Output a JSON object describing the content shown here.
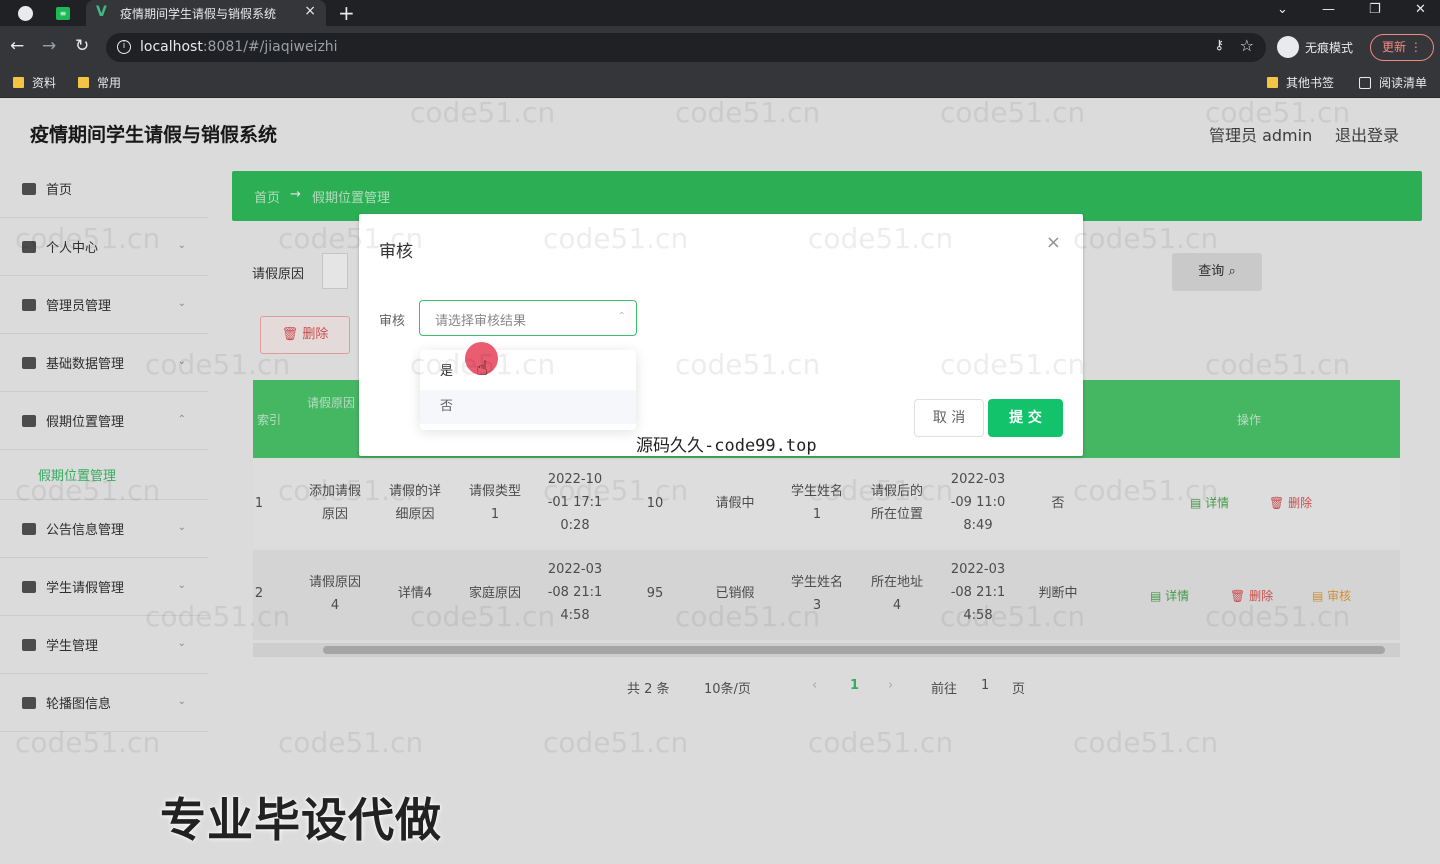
{
  "browser": {
    "tab_title": "疫情期间学生请假与销假系统",
    "url_host": "localhost",
    "url_rest": ":8081/#/jiaqiweizhi",
    "incognito_label": "无痕模式",
    "update_label": "更新",
    "bookmarks": [
      "资料",
      "常用"
    ],
    "bookmarks_right": [
      "其他书签",
      "阅读清单"
    ]
  },
  "header": {
    "system_title": "疫情期间学生请假与销假系统",
    "user": "管理员 admin",
    "logout": "退出登录"
  },
  "sidebar": {
    "items": [
      {
        "label": "首页",
        "icon": "home-icon"
      },
      {
        "label": "个人中心",
        "icon": "user-icon"
      },
      {
        "label": "管理员管理",
        "icon": "admin-icon"
      },
      {
        "label": "基础数据管理",
        "icon": "data-icon"
      },
      {
        "label": "假期位置管理",
        "icon": "location-icon"
      },
      {
        "label": "公告信息管理",
        "icon": "notice-icon"
      },
      {
        "label": "学生请假管理",
        "icon": "leave-icon"
      },
      {
        "label": "学生管理",
        "icon": "student-icon"
      },
      {
        "label": "轮播图信息",
        "icon": "carousel-icon"
      }
    ],
    "active_sub": "假期位置管理"
  },
  "breadcrumb": {
    "home": "首页",
    "arrow": "→",
    "current": "假期位置管理"
  },
  "search": {
    "label": "请假原因",
    "query_button": "查询"
  },
  "toolbar": {
    "delete_button": "删除"
  },
  "table": {
    "headers": [
      "索引",
      "请假原因",
      "操作"
    ],
    "rows": [
      {
        "index": "1",
        "reason": [
          "添加请假",
          "原因"
        ],
        "detail": [
          "请假的详",
          "细原因"
        ],
        "type": [
          "请假类型",
          "1"
        ],
        "time": [
          "2022-10",
          "-01 17:1",
          "0:28"
        ],
        "days": "10",
        "status": "请假中",
        "student": [
          "学生姓名",
          "1"
        ],
        "location": [
          "请假后的",
          "所在位置"
        ],
        "create_time": [
          "2022-03",
          "-09 11:0",
          "8:49"
        ],
        "audit": "否",
        "actions": [
          "详情",
          "删除"
        ]
      },
      {
        "index": "2",
        "reason": [
          "请假原因",
          "4"
        ],
        "detail": [
          "详情4"
        ],
        "type": [
          "家庭原因"
        ],
        "time": [
          "2022-03",
          "-08 21:1",
          "4:58"
        ],
        "days": "95",
        "status": "已销假",
        "student": [
          "学生姓名",
          "3"
        ],
        "location": [
          "所在地址",
          "4"
        ],
        "create_time": [
          "2022-03",
          "-08 21:1",
          "4:58"
        ],
        "audit": "判断中",
        "actions": [
          "详情",
          "删除",
          "审核"
        ]
      }
    ]
  },
  "pagination": {
    "total": "共 2 条",
    "page_size": "10条/页",
    "prev": "‹",
    "current": "1",
    "next": "›",
    "goto_label": "前往",
    "goto_value": "1",
    "page_unit": "页"
  },
  "dialog": {
    "title": "审核",
    "close": "×",
    "field_label": "审核",
    "select_placeholder": "请选择审核结果",
    "options": [
      "是",
      "否"
    ],
    "cancel": "取 消",
    "submit": "提 交"
  },
  "watermarks": {
    "site": "code51.cn",
    "source": "源码久久-code99.top",
    "promo": "专业毕设代做"
  },
  "colors": {
    "accent": "#13c36b",
    "header_green": "#4dcb6e",
    "danger": "#e05656"
  }
}
